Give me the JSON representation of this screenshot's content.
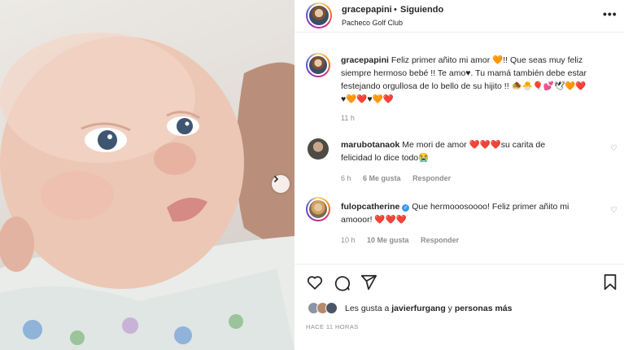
{
  "header": {
    "username": "gracepapini",
    "separator": "•",
    "follow_status": "Siguiendo",
    "location": "Pacheco Golf Club",
    "more_label": "•••"
  },
  "caption": {
    "username": "gracepapini",
    "line1": "Feliz primer añito mi amor 🧡!! Que seas muy feliz",
    "line2": "siempre hermoso bebé !! Te amo♥. Tu mamá también debe estar",
    "line3": "festejando orgullosa de lo bello de su hijito !! 🧆🐣🎈💕🕊🧡❤️",
    "line4": "♥🧡❤️♥🧡❤️",
    "time": "11 h"
  },
  "comments": [
    {
      "username": "marubotanaok",
      "line1": "Me mori de amor ❤️❤️❤️su carita de",
      "line2": "felicidad lo dice todo😭",
      "time": "6 h",
      "likes": "6 Me gusta",
      "reply": "Responder"
    },
    {
      "username": "fulopcatherine",
      "verified_mark": "✓",
      "line1": "Que hermooosoooo! Feliz primer añito mi",
      "line2": "amooor! ❤️❤️❤️",
      "time": "10 h",
      "likes": "10 Me gusta",
      "reply": "Responder"
    }
  ],
  "likes": {
    "prefix": "Les gusta a",
    "user": "javierfurgang",
    "connector": "y",
    "others": "personas más"
  },
  "posted": "HACE 11 HORAS",
  "colors": {
    "accent": "#3897f0",
    "text": "#262626",
    "muted": "#8e8e8e",
    "heart": "#ed4956"
  },
  "icons": [
    "heart-icon",
    "comment-icon",
    "share-icon",
    "bookmark-icon",
    "chevron-right-icon",
    "more-icon"
  ]
}
